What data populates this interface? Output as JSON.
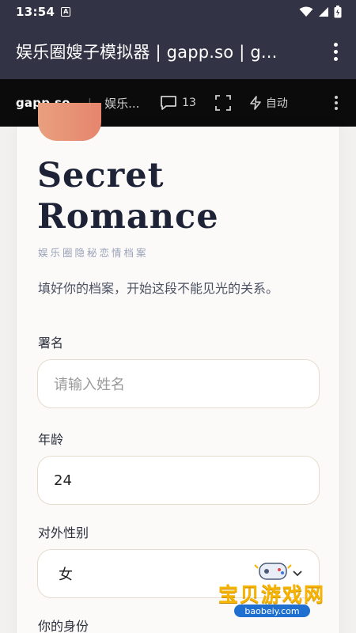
{
  "status_bar": {
    "time": "13:54",
    "notification_badge": "A"
  },
  "title_bar": {
    "title": "娱乐圈嫂子模拟器 | gapp.so | g..."
  },
  "toolbar": {
    "brand_left": "gapp",
    "brand_dot": ".",
    "brand_right": "so",
    "separator": "|",
    "page_name": "娱乐...",
    "comment_count": "13",
    "auto_label": "自动"
  },
  "card": {
    "title_line1": "Secret",
    "title_line2": "Romance",
    "subtitle": "娱乐圈隐秘恋情档案",
    "description": "填好你的档案，开始这段不能见光的关系。"
  },
  "form": {
    "name_label": "署名",
    "name_placeholder": "请输入姓名",
    "age_label": "年龄",
    "age_value": "24",
    "gender_label": "对外性别",
    "gender_value": "女",
    "identity_label": "你的身份"
  },
  "watermark": {
    "text": "宝贝游戏网",
    "url": "baobeiy.com"
  },
  "colors": {
    "status_bar": "#323345",
    "toolbar": "#0b0b0b",
    "card_bg": "#fbfaf8",
    "title": "#1d2236",
    "accent": "#e6856d",
    "input_border": "#e5dccd"
  },
  "icons": [
    "wifi-icon",
    "signal-icon",
    "battery-icon",
    "more-vert-icon",
    "comment-icon",
    "fullscreen-icon",
    "lightning-icon",
    "chevron-down-icon"
  ]
}
